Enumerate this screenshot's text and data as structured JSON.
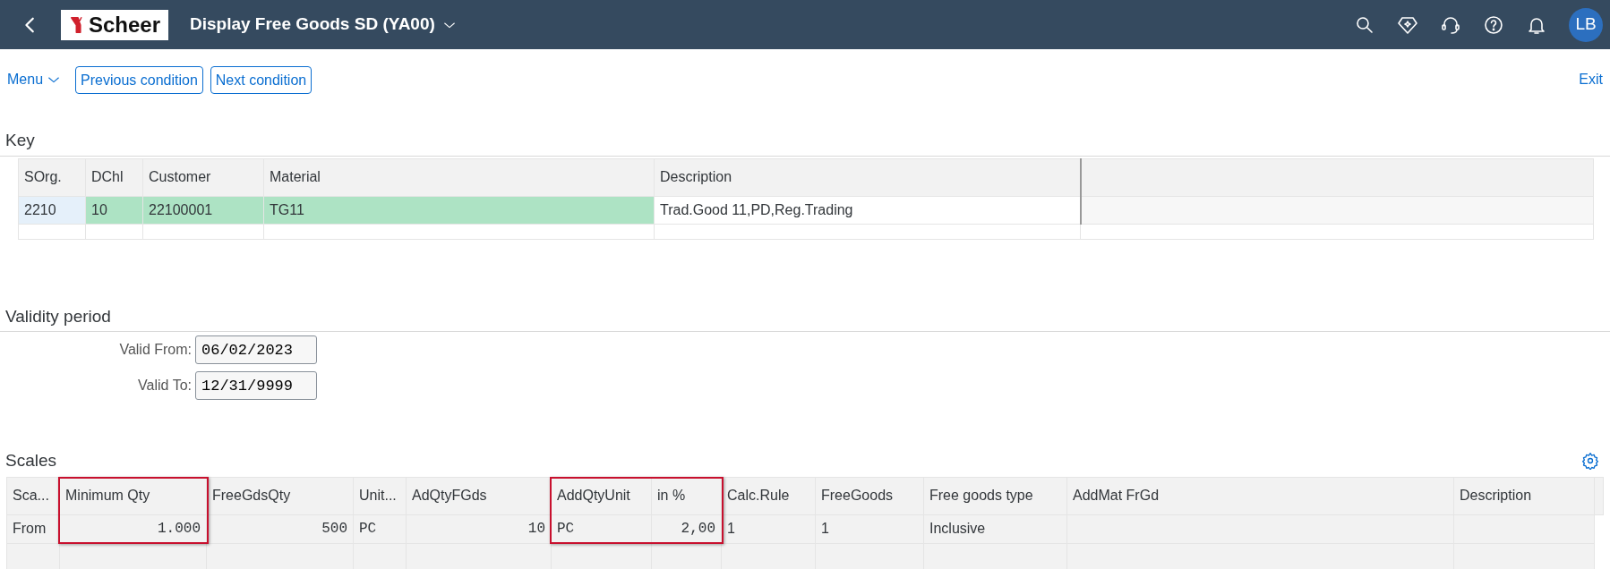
{
  "shell": {
    "logo": "Scheer",
    "title": "Display Free Goods SD (YA00)",
    "avatar": "LB"
  },
  "toolbar": {
    "menu": "Menu",
    "buttons": [
      "Previous condition",
      "Next condition"
    ],
    "exit": "Exit"
  },
  "key": {
    "title": "Key",
    "columns": [
      "SOrg.",
      "DChl",
      "Customer",
      "Material",
      "Description",
      ""
    ],
    "rows": [
      {
        "cells": [
          {
            "text": "2210",
            "kind": "selected"
          },
          {
            "text": "10",
            "kind": "key"
          },
          {
            "text": "22100001",
            "kind": "key"
          },
          {
            "text": "TG11",
            "kind": "key"
          },
          {
            "text": "Trad.Good 11,PD,Reg.Trading",
            "kind": "plain"
          },
          {
            "text": "",
            "kind": "empty"
          }
        ]
      }
    ]
  },
  "validity": {
    "title": "Validity period",
    "fields": [
      {
        "label": "Valid From:",
        "value": "06/02/2023"
      },
      {
        "label": "Valid To:",
        "value": "12/31/9999"
      }
    ]
  },
  "scales": {
    "title": "Scales",
    "columns": [
      {
        "label": "Sca...",
        "highlighted": false,
        "kind": "text"
      },
      {
        "label": "Minimum Qty",
        "highlighted": true,
        "kind": "quantity"
      },
      {
        "label": "FreeGdsQty",
        "highlighted": false,
        "kind": "quantity"
      },
      {
        "label": "Unit...",
        "highlighted": false,
        "kind": "unit"
      },
      {
        "label": "AdQtyFGds",
        "highlighted": false,
        "kind": "quantity"
      },
      {
        "label": "AddQtyUnit",
        "highlighted": true,
        "kind": "unit"
      },
      {
        "label": "in %",
        "highlighted": true,
        "kind": "quantity"
      },
      {
        "label": "Calc.Rule",
        "highlighted": false,
        "kind": "text"
      },
      {
        "label": "FreeGoods",
        "highlighted": false,
        "kind": "text"
      },
      {
        "label": "Free goods type",
        "highlighted": false,
        "kind": "text"
      },
      {
        "label": "AddMat FrGd",
        "highlighted": false,
        "kind": "text"
      },
      {
        "label": "Description",
        "highlighted": false,
        "kind": "text"
      }
    ],
    "rows": [
      [
        "From",
        "1.000",
        "500",
        "PC",
        "10",
        "PC",
        "2,00",
        "1",
        "1",
        "Inclusive",
        "",
        ""
      ],
      [
        "",
        "",
        "",
        "",
        "",
        "",
        "",
        "",
        "",
        "",
        "",
        ""
      ]
    ]
  }
}
